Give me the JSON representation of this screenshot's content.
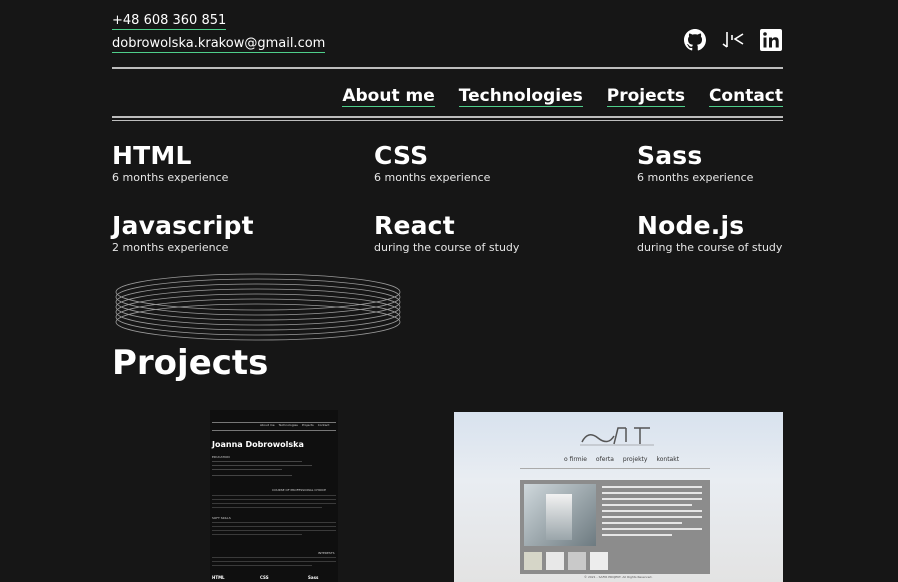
{
  "contact": {
    "phone": "+48 608 360 851",
    "email": "dobrowolska.krakow@gmail.com"
  },
  "socials": [
    {
      "icon": "github-icon"
    },
    {
      "icon": "codewars-icon"
    },
    {
      "icon": "linkedin-icon",
      "label": "in"
    }
  ],
  "nav": {
    "items": [
      "About me",
      "Technologies",
      "Projects",
      "Contact"
    ]
  },
  "technologies": [
    {
      "name": "HTML",
      "experience": "6 months experience"
    },
    {
      "name": "CSS",
      "experience": "6 months experience"
    },
    {
      "name": "Sass",
      "experience": "6 months experience"
    },
    {
      "name": "Javascript",
      "experience": "2 months experience"
    },
    {
      "name": "React",
      "experience": "during the course of study"
    },
    {
      "name": "Node.js",
      "experience": "during the course of study"
    }
  ],
  "projects": {
    "title": "Projects",
    "preview1": {
      "name": "Joanna Dobrowolska",
      "nav": [
        "About me",
        "Technologies",
        "Projects",
        "Contact"
      ],
      "sections": [
        "EDUCATION",
        "COURSE OF PROFESSIONAL CHOICE",
        "SOFT SKILLS",
        "INTERESTS"
      ],
      "footer_tech": [
        "HTML",
        "CSS",
        "Sass"
      ]
    },
    "preview2": {
      "nav": [
        "o firmie",
        "oferta",
        "projekty",
        "kontakt"
      ],
      "footer": "© 2021 - SAFIR PROJEKT. All Rights Reserved."
    }
  },
  "colors": {
    "background": "#161616",
    "accent_underline": "#4fcf8b",
    "rule": "#bdbdbd"
  }
}
